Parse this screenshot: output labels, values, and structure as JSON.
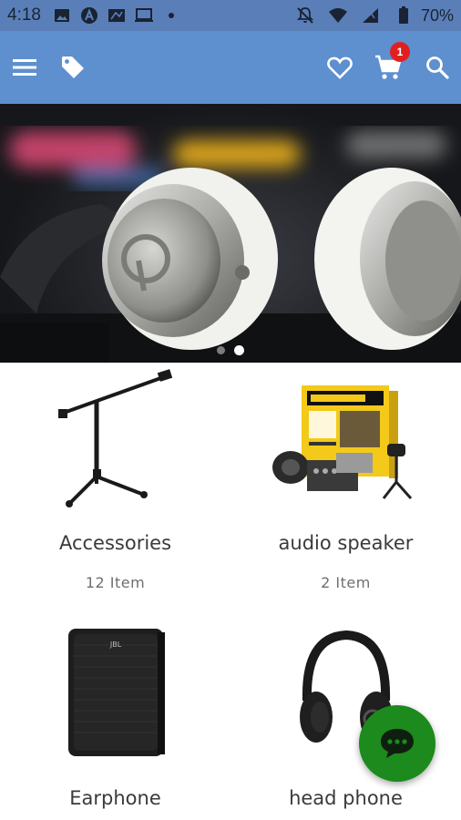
{
  "status_bar": {
    "time": "4:18",
    "battery": "70%",
    "icons_left": [
      "image-icon",
      "a-circle-icon",
      "sim-icon",
      "laptop-icon",
      "dot-icon"
    ],
    "icons_right": [
      "bell-off-icon",
      "wifi-icon",
      "signal-icon",
      "battery-icon"
    ]
  },
  "app_bar": {
    "color": "#5e8fcf",
    "cart_count": "1",
    "icons": [
      "menu-icon",
      "tag-icon",
      "heart-icon",
      "cart-icon",
      "search-icon"
    ]
  },
  "banner": {
    "slides": 2,
    "active_slide": 2
  },
  "categories": [
    {
      "name": "Accessories",
      "count": "12  Item",
      "image": "mic-stand"
    },
    {
      "name": "audio speaker",
      "count": "2  Item",
      "image": "podcast-studio-box"
    },
    {
      "name": "Earphone",
      "count": "",
      "image": "speaker"
    },
    {
      "name": "head phone",
      "count": "",
      "image": "headphones"
    }
  ],
  "fab": {
    "icon": "chat-icon",
    "color": "#1c8a1c"
  }
}
